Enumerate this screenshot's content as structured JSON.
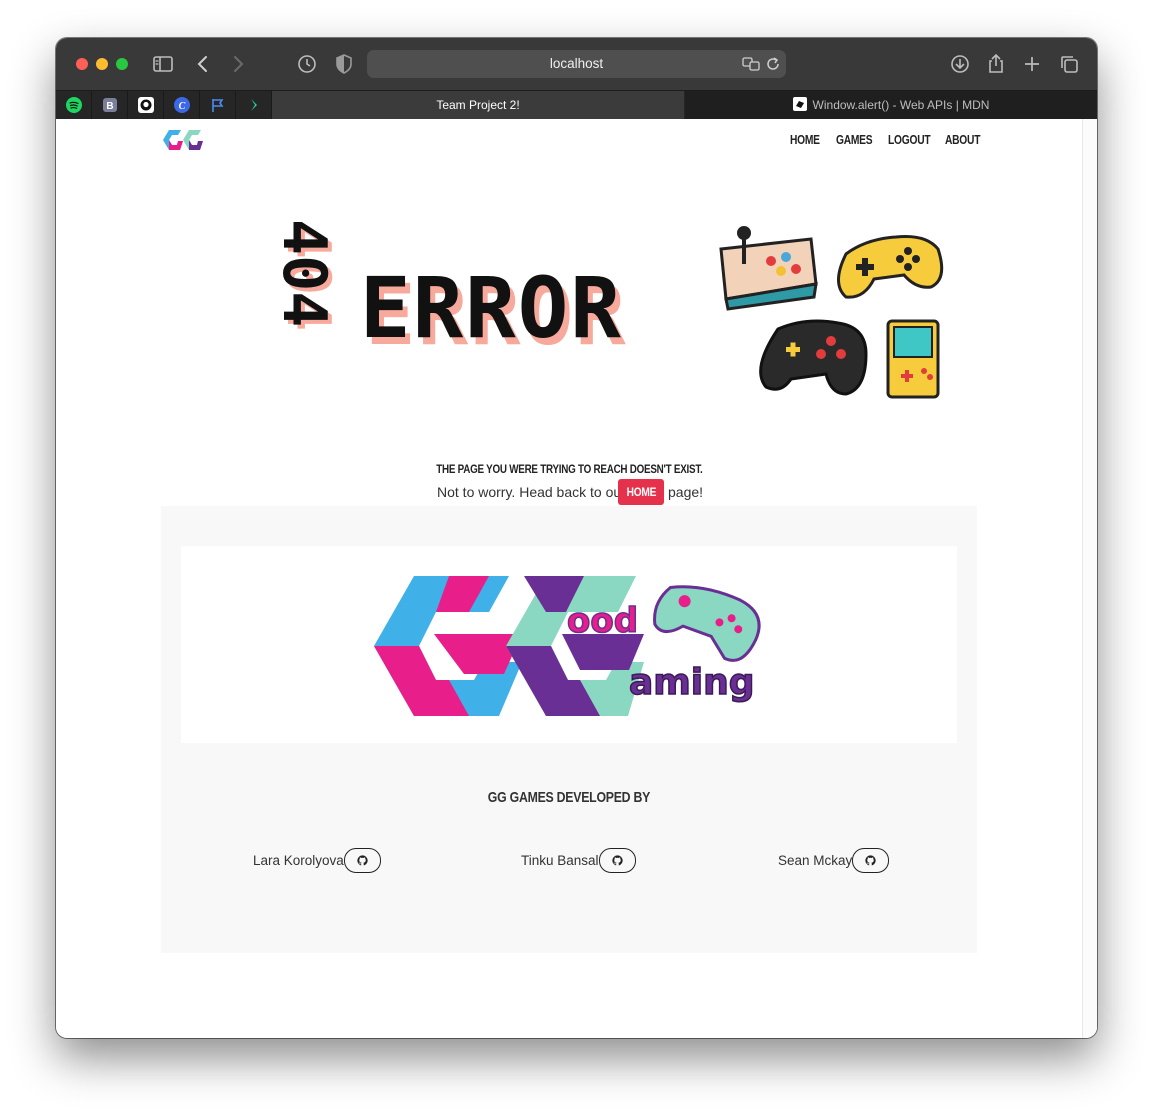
{
  "browser": {
    "url": "localhost",
    "tabs": [
      {
        "title": "Team Project 2!",
        "active": true
      },
      {
        "title": "Window.alert() - Web APIs | MDN",
        "active": false
      }
    ],
    "pinned_tabs": [
      "spotify-icon",
      "bootstrap-icon",
      "github-icon",
      "coursera-icon",
      "flag-icon",
      "app-icon"
    ]
  },
  "nav": {
    "logo": "GG",
    "links": [
      "Home",
      "Games",
      "Logout",
      "About"
    ]
  },
  "hero": {
    "number": "404",
    "word": "ERROR"
  },
  "message": {
    "headline": "The page you were trying to reach doesn't exist.",
    "before": "Not to worry. Head back to our",
    "button": "Home",
    "after": "page!"
  },
  "footer": {
    "logo_text": [
      "ood",
      "aming"
    ],
    "title": "GG Games Developed by",
    "developers": [
      "Lara Korolyova",
      "Tinku Bansal",
      "Sean Mckay"
    ]
  },
  "colors": {
    "accent": "#e5314b",
    "blue": "#3fb0e8",
    "pink": "#e81f8a",
    "teal": "#8ad8c2",
    "purple": "#6a2f94"
  }
}
